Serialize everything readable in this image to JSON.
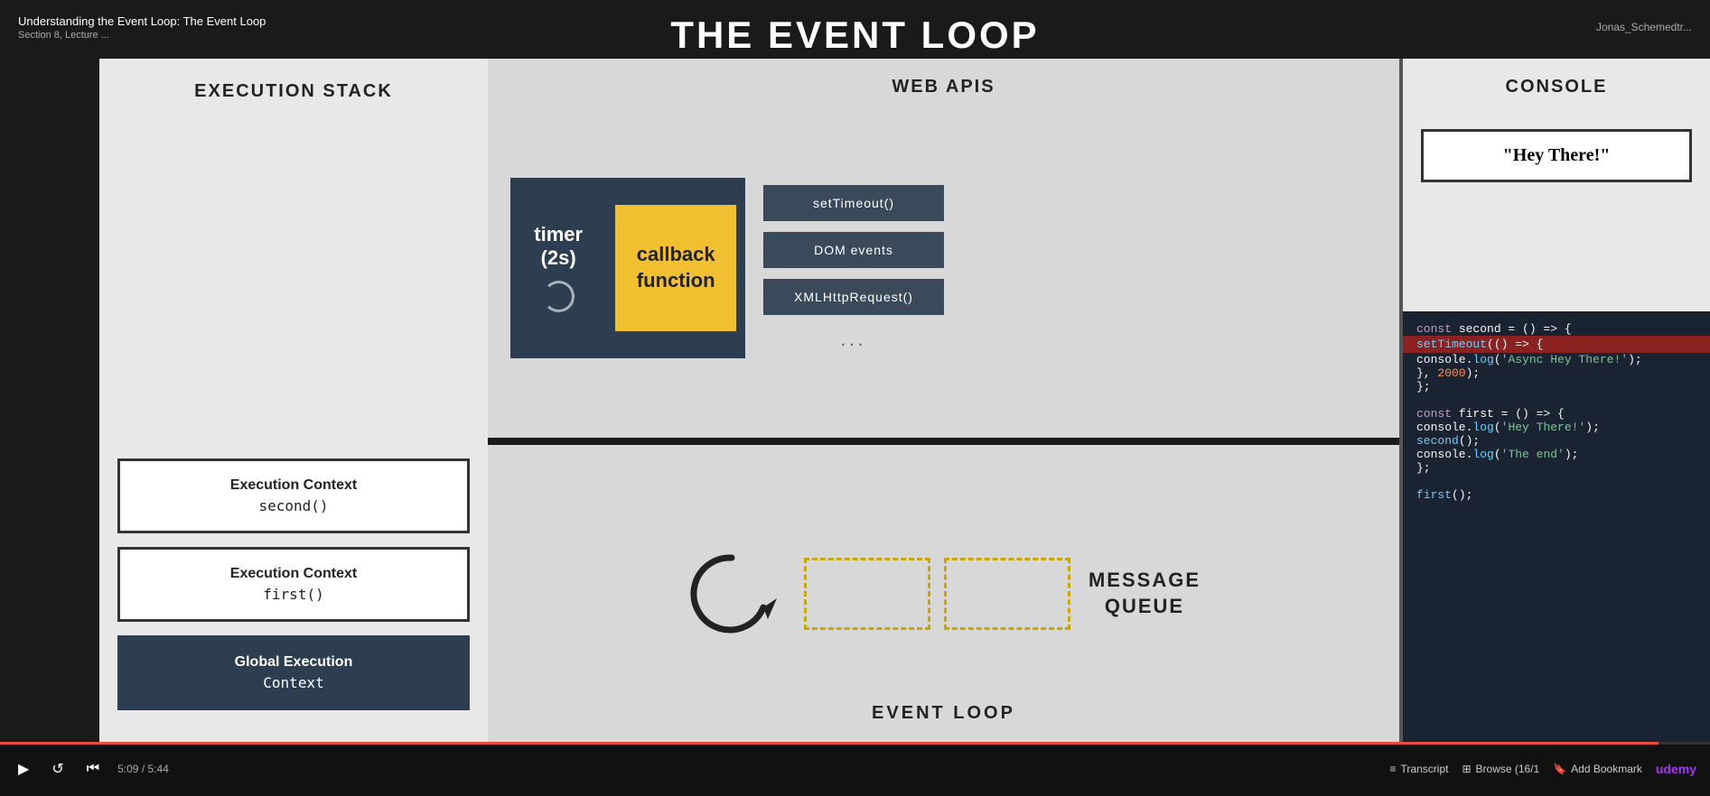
{
  "page": {
    "title": "Understanding the Event Loop: The Event Loop",
    "subtitle": "Section 8, Lecture ...",
    "user": "Jonas_Schemedtr...",
    "bigTitle": "THE EVENT LOOP"
  },
  "executionStack": {
    "panelTitle": "EXECUTION STACK",
    "items": [
      {
        "title": "Execution Context",
        "subtitle": "second()",
        "dark": false
      },
      {
        "title": "Execution Context",
        "subtitle": "first()",
        "dark": false
      },
      {
        "title": "Global Execution Context",
        "subtitle": "",
        "dark": true
      }
    ]
  },
  "webApis": {
    "panelTitle": "WEB APIS",
    "timer": {
      "label": "timer\n(2s)"
    },
    "callback": {
      "label": "callback\nfunction"
    },
    "apiButtons": [
      "setTimeout()",
      "DOM events",
      "XMLHttpRequest()"
    ],
    "dots": "..."
  },
  "eventLoop": {
    "label": "EVENT LOOP",
    "messageQueue": {
      "label": "MESSAGE\nQUEUE"
    }
  },
  "console": {
    "panelTitle": "CONSOLE",
    "value": "\"Hey There!\""
  },
  "code": {
    "lines": [
      {
        "text": "const second = () => {",
        "highlight": false,
        "parts": [
          {
            "type": "keyword",
            "text": "const "
          },
          {
            "type": "var",
            "text": "second "
          },
          {
            "type": "plain",
            "text": "= () => {"
          }
        ]
      },
      {
        "text": "    setTimeout(() => {",
        "highlight": true,
        "parts": [
          {
            "type": "plain",
            "text": "    "
          },
          {
            "type": "func",
            "text": "setTimeout"
          },
          {
            "type": "plain",
            "text": "(() => {"
          }
        ]
      },
      {
        "text": "        console.log('Async Hey There!');",
        "highlight": false,
        "parts": [
          {
            "type": "plain",
            "text": "        console."
          },
          {
            "type": "func",
            "text": "log"
          },
          {
            "type": "plain",
            "text": "("
          },
          {
            "type": "string",
            "text": "'Async Hey There!'"
          },
          {
            "type": "plain",
            "text": ");"
          }
        ]
      },
      {
        "text": "    }, 2000);",
        "highlight": false,
        "parts": [
          {
            "type": "plain",
            "text": "    }, "
          },
          {
            "type": "num",
            "text": "2000"
          },
          {
            "type": "plain",
            "text": ");"
          }
        ]
      },
      {
        "text": "};",
        "highlight": false,
        "parts": [
          {
            "type": "plain",
            "text": "};"
          }
        ]
      },
      {
        "text": "",
        "highlight": false
      },
      {
        "text": "const first = () => {",
        "highlight": false,
        "parts": [
          {
            "type": "keyword",
            "text": "const "
          },
          {
            "type": "var",
            "text": "first "
          },
          {
            "type": "plain",
            "text": "= () => {"
          }
        ]
      },
      {
        "text": "    console.log('Hey There!');",
        "highlight": false,
        "parts": [
          {
            "type": "plain",
            "text": "    console."
          },
          {
            "type": "func",
            "text": "log"
          },
          {
            "type": "plain",
            "text": "("
          },
          {
            "type": "string",
            "text": "'Hey There!'"
          },
          {
            "type": "plain",
            "text": ");"
          }
        ]
      },
      {
        "text": "    second();",
        "highlight": false,
        "parts": [
          {
            "type": "plain",
            "text": "    "
          },
          {
            "type": "func",
            "text": "second"
          },
          {
            "type": "plain",
            "text": "();"
          }
        ]
      },
      {
        "text": "    console.log('The end');",
        "highlight": false,
        "parts": [
          {
            "type": "plain",
            "text": "    console."
          },
          {
            "type": "func",
            "text": "log"
          },
          {
            "type": "plain",
            "text": "("
          },
          {
            "type": "string",
            "text": "'The end'"
          },
          {
            "type": "plain",
            "text": ");"
          }
        ]
      },
      {
        "text": "};",
        "highlight": false,
        "parts": [
          {
            "type": "plain",
            "text": "};"
          }
        ]
      },
      {
        "text": "",
        "highlight": false
      },
      {
        "text": "first();",
        "highlight": false,
        "parts": [
          {
            "type": "func",
            "text": "first"
          },
          {
            "type": "plain",
            "text": "();"
          }
        ]
      }
    ]
  },
  "bottomBar": {
    "time": "5:09 / 5:44",
    "transcript": "Transcript",
    "browse": "Browse (16/1",
    "addBookmark": "Add Bookmark"
  }
}
